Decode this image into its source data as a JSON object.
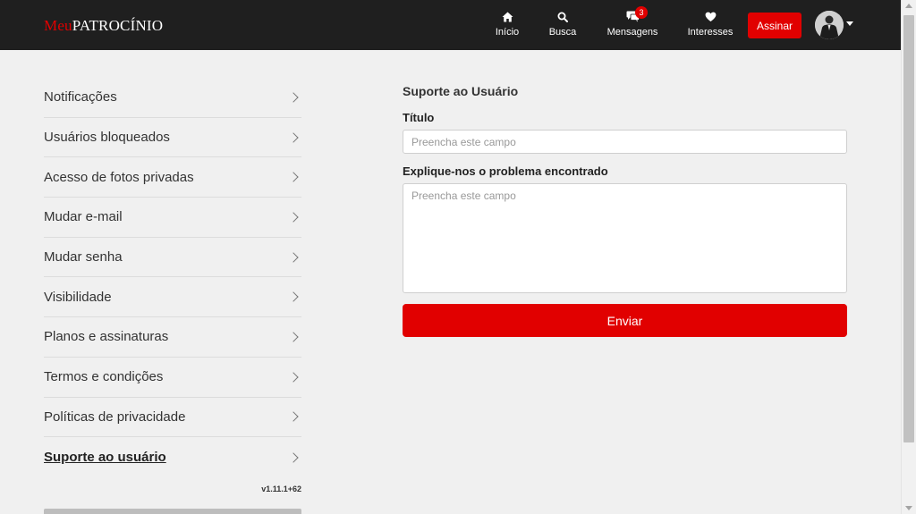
{
  "header": {
    "logo_part1": "Meu",
    "logo_part2": "PATROCÍNIO",
    "nav": [
      {
        "label": "Início",
        "icon": "home-icon"
      },
      {
        "label": "Busca",
        "icon": "search-icon"
      },
      {
        "label": "Mensagens",
        "icon": "messages-icon",
        "badge": "3"
      },
      {
        "label": "Interesses",
        "icon": "heart-icon"
      }
    ],
    "subscribe_label": "Assinar",
    "colors": {
      "bar": "#1f1f1f",
      "accent": "#e10000"
    }
  },
  "sidebar": {
    "items": [
      {
        "label": "Notificações"
      },
      {
        "label": "Usuários bloqueados"
      },
      {
        "label": "Acesso de fotos privadas"
      },
      {
        "label": "Mudar e-mail"
      },
      {
        "label": "Mudar senha"
      },
      {
        "label": "Visibilidade"
      },
      {
        "label": "Planos e assinaturas"
      },
      {
        "label": "Termos e condições"
      },
      {
        "label": "Políticas de privacidade"
      },
      {
        "label": "Suporte ao usuário",
        "active": true
      }
    ],
    "version": "v1.11.1+62"
  },
  "form": {
    "title": "Suporte ao Usuário",
    "title_label": "Título",
    "title_placeholder": "Preencha este campo",
    "problem_label": "Explique-nos o problema encontrado",
    "problem_placeholder": "Preencha este campo",
    "submit_label": "Enviar"
  }
}
